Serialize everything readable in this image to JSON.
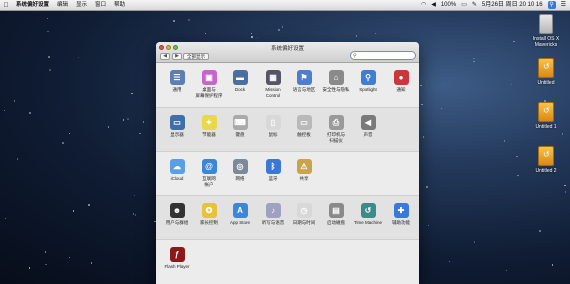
{
  "menubar": {
    "app_name": "系统偏好设置",
    "menus": [
      "编辑",
      "显示",
      "窗口",
      "帮助"
    ],
    "battery": "100%",
    "clock": "5月26日 周日 20 10 16"
  },
  "window": {
    "title": "系统偏好设置",
    "back": "◀",
    "forward": "▶",
    "show_all": "全部显示",
    "search_placeholder": ""
  },
  "sections": [
    {
      "id": "personal",
      "panes": [
        {
          "label": "通用",
          "icon": "general-icon",
          "color": "#5a7fb0"
        },
        {
          "label": "桌面与\n屏幕保护程序",
          "icon": "desktop-screensaver-icon",
          "color": "#c865c8"
        },
        {
          "label": "Dock",
          "icon": "dock-icon",
          "color": "#4a6ea0"
        },
        {
          "label": "Mission\nControl",
          "icon": "mission-control-icon",
          "color": "#556"
        },
        {
          "label": "语言与地区",
          "icon": "language-region-icon",
          "color": "#4e7ecf"
        },
        {
          "label": "安全性与隐私",
          "icon": "security-privacy-icon",
          "color": "#8a8a8a"
        },
        {
          "label": "Spotlight",
          "icon": "spotlight-icon",
          "color": "#3e7fd5"
        },
        {
          "label": "通知",
          "icon": "notifications-icon",
          "color": "#c8383a"
        }
      ]
    },
    {
      "id": "hardware",
      "panes": [
        {
          "label": "显示器",
          "icon": "displays-icon",
          "color": "#3e6fa8"
        },
        {
          "label": "节能器",
          "icon": "energy-saver-icon",
          "color": "#e8d84a"
        },
        {
          "label": "键盘",
          "icon": "keyboard-icon",
          "color": "#aaaaaa"
        },
        {
          "label": "鼠标",
          "icon": "mouse-icon",
          "color": "#d8d8d8"
        },
        {
          "label": "触控板",
          "icon": "trackpad-icon",
          "color": "#b9b9b9"
        },
        {
          "label": "打印机与\n扫描仪",
          "icon": "printer-icon",
          "color": "#9a9a9a"
        },
        {
          "label": "声音",
          "icon": "sound-icon",
          "color": "#7a7a7a"
        }
      ]
    },
    {
      "id": "internet",
      "panes": [
        {
          "label": "iCloud",
          "icon": "icloud-icon",
          "color": "#5a9ee6"
        },
        {
          "label": "互联网\n帐户",
          "icon": "internet-accounts-icon",
          "color": "#3b86d6"
        },
        {
          "label": "网络",
          "icon": "network-icon",
          "color": "#7a8a9a"
        },
        {
          "label": "蓝牙",
          "icon": "bluetooth-icon",
          "color": "#3a78d2"
        },
        {
          "label": "共享",
          "icon": "sharing-icon",
          "color": "#c9a44a"
        }
      ]
    },
    {
      "id": "system",
      "panes": [
        {
          "label": "用户与群组",
          "icon": "users-groups-icon",
          "color": "#333333"
        },
        {
          "label": "家长控制",
          "icon": "parental-controls-icon",
          "color": "#e8c23a"
        },
        {
          "label": "App Store",
          "icon": "app-store-icon",
          "color": "#3e86d6"
        },
        {
          "label": "听写与语音",
          "icon": "dictation-speech-icon",
          "color": "#a0a0c0"
        },
        {
          "label": "日期与时间",
          "icon": "date-time-icon",
          "color": "#d8d8d8"
        },
        {
          "label": "启动磁盘",
          "icon": "startup-disk-icon",
          "color": "#8a8a8a"
        },
        {
          "label": "Time Machine",
          "icon": "time-machine-icon",
          "color": "#3d8a8a"
        },
        {
          "label": "辅助功能",
          "icon": "accessibility-icon",
          "color": "#3a7ad6"
        }
      ]
    },
    {
      "id": "other",
      "panes": [
        {
          "label": "Flash Player",
          "icon": "flash-player-icon",
          "color": "#8a1a1a"
        }
      ]
    }
  ],
  "desktop_icons": [
    {
      "label": "Install OS X\nMavericks",
      "icon": "installer-icon"
    },
    {
      "label": "Untitled",
      "icon": "drive-icon"
    },
    {
      "label": "Untitled 1",
      "icon": "drive-icon"
    },
    {
      "label": "Untitled 2",
      "icon": "drive-icon"
    }
  ]
}
